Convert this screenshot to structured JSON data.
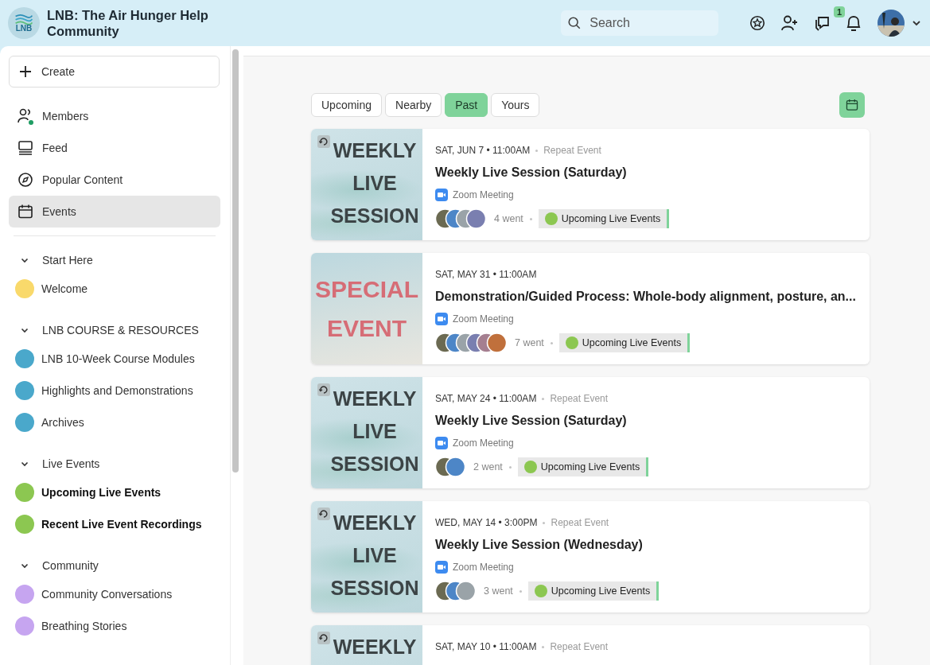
{
  "header": {
    "logo_text": "LNB",
    "title": "LNB: The Air Hunger Help Community",
    "search": {
      "placeholder": "Search"
    },
    "notification_count": "1"
  },
  "sidebar": {
    "create": "Create",
    "nav": [
      {
        "label": "Members",
        "kind": "members",
        "selected": false,
        "online": true
      },
      {
        "label": "Feed",
        "kind": "feed",
        "selected": false,
        "online": false
      },
      {
        "label": "Popular Content",
        "kind": "compass",
        "selected": false,
        "online": false
      },
      {
        "label": "Events",
        "kind": "calendar",
        "selected": true,
        "online": false
      }
    ],
    "sections": [
      {
        "title": "Start Here",
        "expanded": true,
        "channels": [
          {
            "label": "Welcome",
            "color": "#f9d96b",
            "unread": false
          }
        ]
      },
      {
        "title": "LNB COURSE & RESOURCES",
        "expanded": true,
        "channels": [
          {
            "label": "LNB 10-Week Course Modules",
            "color": "#4aa8cb",
            "unread": false
          },
          {
            "label": "Highlights and Demonstrations",
            "color": "#4aa8cb",
            "unread": false
          },
          {
            "label": "Archives",
            "color": "#4aa8cb",
            "unread": false
          }
        ]
      },
      {
        "title": "Live Events",
        "expanded": true,
        "channels": [
          {
            "label": "Upcoming Live Events",
            "color": "#8cc751",
            "unread": true
          },
          {
            "label": "Recent Live Event Recordings",
            "color": "#8cc751",
            "unread": true
          }
        ]
      },
      {
        "title": "Community",
        "expanded": true,
        "channels": [
          {
            "label": "Community Conversations",
            "color": "#c6a5f0",
            "unread": false
          },
          {
            "label": "Breathing Stories",
            "color": "#c6a5f0",
            "unread": false
          }
        ]
      }
    ]
  },
  "tabs": [
    {
      "label": "Upcoming",
      "selected": false
    },
    {
      "label": "Nearby",
      "selected": false
    },
    {
      "label": "Past",
      "selected": true
    },
    {
      "label": "Yours",
      "selected": false
    }
  ],
  "events": [
    {
      "banner": {
        "kind": "weekly",
        "lines": [
          "WEEKLY",
          "LIVE",
          "SESSION"
        ]
      },
      "repeat": true,
      "date": "SAT, JUN 7 • 11:00AM",
      "repeat_label": "Repeat Event",
      "title": "Weekly Live Session (Saturday)",
      "location": "Zoom Meeting",
      "went": "4 went",
      "tag": {
        "label": "Upcoming Live Events",
        "color": "#8cc751"
      }
    },
    {
      "banner": {
        "kind": "special",
        "lines": [
          "SPECIAL",
          "EVENT"
        ]
      },
      "repeat": false,
      "date": "SAT, MAY 31 • 11:00AM",
      "title": "Demonstration/Guided Process: Whole-body alignment, posture, an...",
      "location": "Zoom Meeting",
      "went": "7 went",
      "tag": {
        "label": "Upcoming Live Events",
        "color": "#8cc751"
      }
    },
    {
      "banner": {
        "kind": "weekly",
        "lines": [
          "WEEKLY",
          "LIVE",
          "SESSION"
        ]
      },
      "repeat": true,
      "date": "SAT, MAY 24 • 11:00AM",
      "repeat_label": "Repeat Event",
      "title": "Weekly Live Session (Saturday)",
      "location": "Zoom Meeting",
      "went": "2 went",
      "tag": {
        "label": "Upcoming Live Events",
        "color": "#8cc751"
      }
    },
    {
      "banner": {
        "kind": "weekly",
        "lines": [
          "WEEKLY",
          "LIVE",
          "SESSION"
        ]
      },
      "repeat": true,
      "date": "WED, MAY 14 • 3:00PM",
      "repeat_label": "Repeat Event",
      "title": "Weekly Live Session (Wednesday)",
      "location": "Zoom Meeting",
      "went": "3 went",
      "tag": {
        "label": "Upcoming Live Events",
        "color": "#8cc751"
      }
    },
    {
      "banner": {
        "kind": "weekly",
        "lines": [
          "WEEKLY"
        ]
      },
      "repeat": true,
      "date": "SAT, MAY 10 • 11:00AM",
      "repeat_label": "Repeat Event"
    }
  ]
}
